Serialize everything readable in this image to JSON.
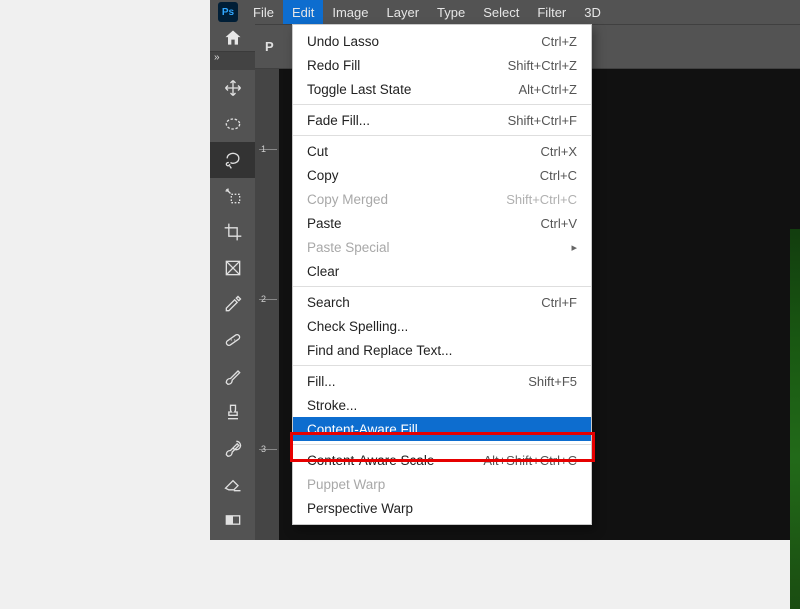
{
  "app_icon_text": "Ps",
  "menubar": {
    "items": [
      "File",
      "Edit",
      "Image",
      "Layer",
      "Type",
      "Select",
      "Filter",
      "3D"
    ],
    "open_index": 1
  },
  "options_bar": {
    "label": "P"
  },
  "ruler": {
    "ticks": [
      "1",
      "2",
      "3"
    ]
  },
  "tools": [
    {
      "name": "move-tool",
      "type": "move"
    },
    {
      "name": "marquee-tool",
      "type": "ellipse-dashed"
    },
    {
      "name": "lasso-tool",
      "type": "lasso",
      "selected": true
    },
    {
      "name": "quick-select-tool",
      "type": "wand-rect"
    },
    {
      "name": "crop-tool",
      "type": "crop"
    },
    {
      "name": "frame-tool",
      "type": "frame-x"
    },
    {
      "name": "eyedropper-tool",
      "type": "eyedropper"
    },
    {
      "name": "healing-brush-tool",
      "type": "bandage"
    },
    {
      "name": "brush-tool",
      "type": "brush"
    },
    {
      "name": "clone-stamp-tool",
      "type": "stamp"
    },
    {
      "name": "history-brush-tool",
      "type": "history-brush"
    },
    {
      "name": "eraser-tool",
      "type": "eraser"
    },
    {
      "name": "gradient-tool",
      "type": "gradient"
    }
  ],
  "edit_menu": [
    {
      "label": "Undo Lasso",
      "shortcut": "Ctrl+Z"
    },
    {
      "label": "Redo Fill",
      "shortcut": "Shift+Ctrl+Z"
    },
    {
      "label": "Toggle Last State",
      "shortcut": "Alt+Ctrl+Z"
    },
    {
      "sep": true
    },
    {
      "label": "Fade Fill...",
      "shortcut": "Shift+Ctrl+F"
    },
    {
      "sep": true
    },
    {
      "label": "Cut",
      "shortcut": "Ctrl+X"
    },
    {
      "label": "Copy",
      "shortcut": "Ctrl+C"
    },
    {
      "label": "Copy Merged",
      "shortcut": "Shift+Ctrl+C",
      "disabled": true
    },
    {
      "label": "Paste",
      "shortcut": "Ctrl+V"
    },
    {
      "label": "Paste Special",
      "submenu": true,
      "disabled": true
    },
    {
      "label": "Clear"
    },
    {
      "sep": true
    },
    {
      "label": "Search",
      "shortcut": "Ctrl+F"
    },
    {
      "label": "Check Spelling..."
    },
    {
      "label": "Find and Replace Text..."
    },
    {
      "sep": true
    },
    {
      "label": "Fill...",
      "shortcut": "Shift+F5"
    },
    {
      "label": "Stroke..."
    },
    {
      "label": "Content-Aware Fill...",
      "highlight": true
    },
    {
      "sep": true
    },
    {
      "label": "Content-Aware Scale",
      "shortcut": "Alt+Shift+Ctrl+C"
    },
    {
      "label": "Puppet Warp",
      "disabled": true
    },
    {
      "label": "Perspective Warp"
    }
  ]
}
